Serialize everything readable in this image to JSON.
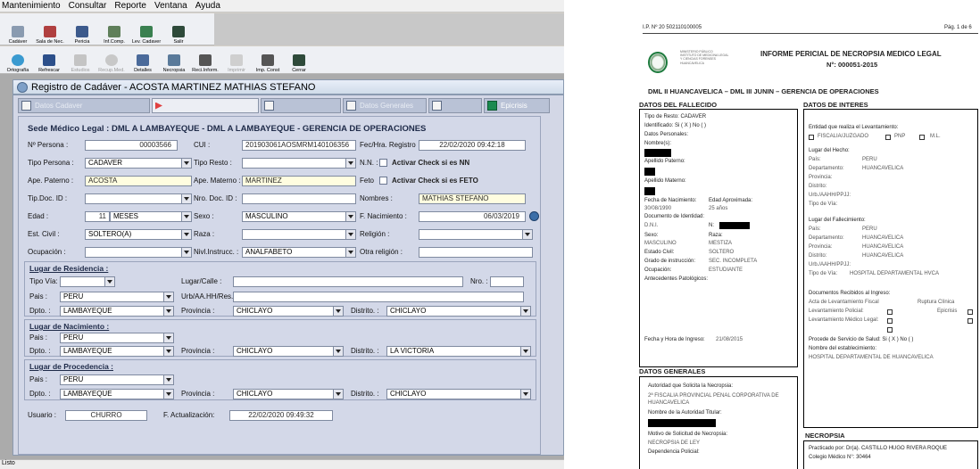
{
  "app": {
    "menu": [
      "Mantenimiento",
      "Consultar",
      "Reporte",
      "Ventana",
      "Ayuda"
    ],
    "toolbar1": [
      "Cadáver",
      "Sala de Nec.",
      "Pericia",
      "Inf.Comp.",
      "Lev. Cadaver",
      "Salir"
    ],
    "toolbar2": [
      {
        "label": "Ortografía",
        "disabled": false
      },
      {
        "label": "Refrescar",
        "disabled": false
      },
      {
        "label": "Estudios",
        "disabled": true
      },
      {
        "label": "Recup.Med.",
        "disabled": true
      },
      {
        "label": "Detalles",
        "disabled": false
      },
      {
        "label": "Necropsia",
        "disabled": false
      },
      {
        "label": "Reci.Inform.",
        "disabled": false
      },
      {
        "label": "Imprimir",
        "disabled": true
      },
      {
        "label": "Imp. Const",
        "disabled": false
      },
      {
        "label": "Cerrar",
        "disabled": false
      }
    ],
    "window_title": "Registro de Cadáver - ACOSTA MARTINEZ MATHIAS STEFANO",
    "tabs": {
      "t1": "Datos Cadaver",
      "t3": "Datos Generales",
      "t5": "Epicrisis"
    },
    "form": {
      "sede": "Sede Médico Legal : DML A  LAMBAYEQUE - DML A LAMBAYEQUE - GERENCIA DE OPERACIONES",
      "labels": {
        "n_persona": "Nº Persona :",
        "cui": "CUI :",
        "fec_reg": "Fec/Hra. Registro",
        "tipo_persona": "Tipo Persona :",
        "tipo_resto": "Tipo Resto :",
        "nn": "N.N. :",
        "ape_paterno": "Ape. Paterno :",
        "ape_materno": "Ape. Materno :",
        "feto": "Feto",
        "tip_doc": "Tip.Doc. ID :",
        "nro_doc": "Nro. Doc. ID :",
        "nombres": "Nombres :",
        "edad": "Edad :",
        "sexo": "Sexo :",
        "f_nac": "F. Nacimiento :",
        "est_civil": "Est. Civil :",
        "raza": "Raza :",
        "religion": "Religión :",
        "ocupacion": "Ocupación :",
        "nivel": "Nivl.Instrucc. :",
        "otra_rel": "Otra religión :",
        "tipo_via": "Tipo Vía:",
        "lugar_calle": "Lugar/Calle :",
        "nro": "Nro. :",
        "pais": "Pais :",
        "urb": "Urb/AA.HH/Res.",
        "dpto": "Dpto. :",
        "provincia": "Provincia :",
        "distrito": "Distrito. :",
        "usuario": "Usuario :",
        "f_act": "F. Actualización:"
      },
      "values": {
        "n_persona": "00003566",
        "cui": "201903061AOSMRM140106356",
        "fec_reg": "22/02/2020 09:42:18",
        "tipo_persona": "CADAVER",
        "tipo_resto": "",
        "ape_paterno": "ACOSTA",
        "ape_materno": "MARTINEZ",
        "tip_doc": "",
        "nro_doc": "",
        "nombres": "MATHIAS STEFANO",
        "edad_num": "11",
        "edad_unit": "MESES",
        "sexo": "MASCULINO",
        "f_nac": "06/03/2019",
        "est_civil": "SOLTERO(A)",
        "raza": "",
        "religion": "",
        "ocupacion": "",
        "nivel": "ANALFABETO",
        "otra_rel": ""
      },
      "check_nn": "Activar Check si es NN",
      "check_feto": "Activar Check si es FETO",
      "residencia": {
        "title": "Lugar de Residencia :",
        "tipo_via": "",
        "lugar": "",
        "nro": "",
        "pais": "PERU",
        "urb": "",
        "dpto": "LAMBAYEQUE",
        "prov": "CHICLAYO",
        "dist": "CHICLAYO"
      },
      "nacimiento": {
        "title": "Lugar de Nacimiento :",
        "pais": "PERU",
        "dpto": "LAMBAYEQUE",
        "prov": "CHICLAYO",
        "dist": "LA VICTORIA"
      },
      "procedencia": {
        "title": "Lugar de Procedencia :",
        "pais": "PERU",
        "dpto": "LAMBAYEQUE",
        "prov": "CHICLAYO",
        "dist": "CHICLAYO"
      },
      "usuario": "CHURRO",
      "f_act": "22/02/2020 09:49:32"
    },
    "status": "Listo"
  },
  "doc": {
    "ref": "I.P. Nº 20 502110100005",
    "page": "Pág. 1 de 6",
    "seal_text": [
      "MINISTERIO PÚBLICO",
      "INSTITUTO DE MEDICINA LEGAL",
      "Y CIENCIAS FORENSES",
      "HUANCAVELICA"
    ],
    "title": "INFORME PERICIAL DE NECROPSIA MEDICO LEGAL",
    "number": "N°: 000051-2015",
    "subtitle": "DML II HUANCAVELICA – DML III JUNIN – GERENCIA DE OPERACIONES",
    "fallecido": {
      "title": "DATOS DEL FALLECIDO",
      "tipo_resto": "Tipo de Resto: CADAVER",
      "identificado": "Identificado:  Si ( X )   No (  )",
      "datos_personales": "Datos Personales:",
      "nombres": "Nombre(s):",
      "ap_paterno": "Apellido Paterno:",
      "ap_materno": "Apellido Materno:",
      "f_nac_label": "Fecha de Nacimiento:",
      "f_nac": "30/08/1990",
      "edad_label": "Edad Aproximada:",
      "edad": "25 años",
      "doc_id": "Documento de Identidad:",
      "dni": "D.N.I.",
      "n": "N:",
      "sexo_label": "Sexo:",
      "sexo": "MASCULINO",
      "raza_label": "Raza:",
      "raza": "MESTIZA",
      "civil_label": "Estado Civil:",
      "civil": "SOLTERO",
      "grado_label": "Grado de instrucción:",
      "grado": "SEC. INCOMPLETA",
      "ocup_label": "Ocupación:",
      "ocup": "ESTUDIANTE",
      "antecedentes": "Antecedentes Patológicos:",
      "ingreso_label": "Fecha y Hora de Ingreso:",
      "ingreso": "21/08/2015"
    },
    "generales": {
      "title": "DATOS GENERALES",
      "autoridad_label": "Autoridad que Solicita la Necropsia:",
      "autoridad": "2ª FISCALIA PROVINCIAL PENAL CORPORATIVA DE HUANCAVELICA",
      "titular_label": "Nombre de la Autoridad Titular:",
      "motivo_label": "Motivo de Solicitud de Necropsia:",
      "motivo": "NECROPSIA DE LEY",
      "dependencia_label": "Dependencia Policial:"
    },
    "interes": {
      "title": "DATOS DE INTERES",
      "entidad_label": "Entidad que realiza el Levantamiento:",
      "entidad_opts": [
        "FISCALIA/JUZGADO",
        "PNP",
        "M.L."
      ],
      "lugar_hecho": "Lugar del Hecho:",
      "pais": "País:",
      "pais_v": "PERU",
      "dpto": "Departamento:",
      "dpto_v": "HUANCAVELICA",
      "prov": "Provincia:",
      "dist": "Distrito:",
      "urb": "Urb./AAHH/PPJJ:",
      "via": "Tipo de Vía:",
      "lugar_fallec": "Lugar del Fallecimiento:",
      "prov_v": "HUANCAVELICA",
      "dist_v": "HUANCAVELICA",
      "via_v": "HOSPITAL DEPARTAMENTAL HVCA",
      "docs_label": "Documentos Recibidos al Ingreso:",
      "acta": "Acta de Levantamiento Fiscal",
      "ruptura": "Ruptura Clínica",
      "lev_pol": "Levantamiento Policial:",
      "epicrisis": "Epicrisis",
      "lev_med": "Levantamiento Médico Legal:",
      "procede": "Procede de Servicio de Salud:   Si ( X )   No (  )",
      "estab_label": "Nombre del establecimiento:",
      "estab": "HOSPITAL DEPARTAMENTAL DE HUANCAVELICA"
    },
    "necropsia": {
      "title": "NECROPSIA",
      "practicado": "Practicado por: Dr(a). CASTILLO HUGO RIVERA ROQUE",
      "colegio": "Colegio Médico N°: 30464"
    }
  }
}
